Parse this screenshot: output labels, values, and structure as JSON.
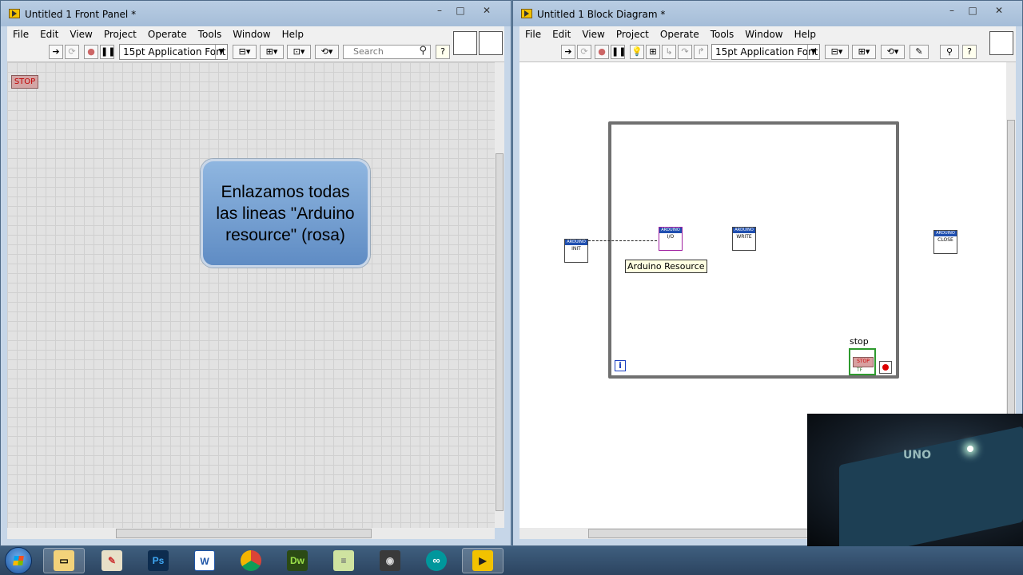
{
  "front_panel": {
    "title": "Untitled 1 Front Panel *",
    "menu": [
      "File",
      "Edit",
      "View",
      "Project",
      "Operate",
      "Tools",
      "Window",
      "Help"
    ],
    "font_selector": "15pt Application Font",
    "search_placeholder": "Search",
    "stop_button_label": "STOP",
    "note_text": "Enlazamos todas las lineas \"Arduino resource\" (rosa)"
  },
  "block_diagram": {
    "title": "Untitled 1 Block Diagram *",
    "menu": [
      "File",
      "Edit",
      "View",
      "Project",
      "Operate",
      "Tools",
      "Window",
      "Help"
    ],
    "font_selector": "15pt Application Font",
    "nodes": {
      "init": "INIT",
      "io": "I/O",
      "write": "WRITE",
      "close": "CLOSE",
      "header": "ARDUINO"
    },
    "tooltip": "Arduino Resource",
    "stop_label": "stop",
    "stop_control_text": "STOP",
    "stop_control_tf": "TF",
    "loop_index": "i"
  },
  "webcam": {
    "board_text": "UNO"
  },
  "taskbar": {
    "apps": [
      {
        "name": "Explorer",
        "icon": "folder-icon"
      },
      {
        "name": "Paint",
        "icon": "paint-icon"
      },
      {
        "name": "Photoshop",
        "label": "Ps"
      },
      {
        "name": "Word",
        "label": "W"
      },
      {
        "name": "Chrome",
        "icon": "chrome-icon"
      },
      {
        "name": "Dreamweaver",
        "label": "Dw"
      },
      {
        "name": "Notes",
        "icon": "notes-icon"
      },
      {
        "name": "Camera",
        "icon": "camera-icon"
      },
      {
        "name": "Arduino",
        "icon": "arduino-icon"
      },
      {
        "name": "LabVIEW",
        "icon": "labview-icon"
      }
    ]
  },
  "colors": {
    "labview_pink": "#d4a5a5",
    "node_header_blue": "#1f4fb0",
    "note_blue": "#6f9bd2",
    "stop_green": "#2e9a2e"
  }
}
